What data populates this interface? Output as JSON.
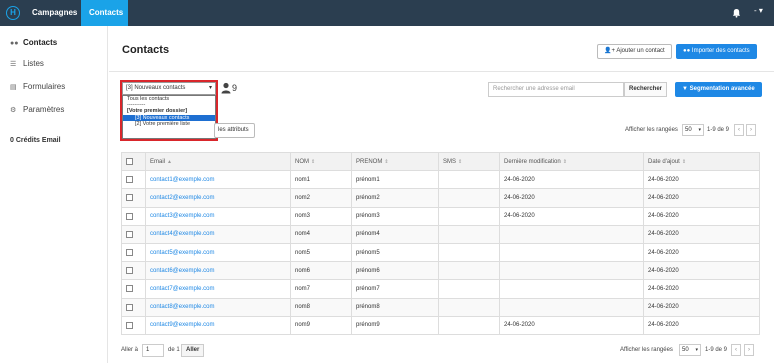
{
  "topnav": {
    "logo": "H",
    "tabs": [
      {
        "label": "Campagnes"
      },
      {
        "label": "Contacts"
      }
    ],
    "user_label": "-"
  },
  "sidebar": {
    "items": [
      {
        "label": "Contacts",
        "icon": "users-icon"
      },
      {
        "label": "Listes",
        "icon": "list-icon"
      },
      {
        "label": "Formulaires",
        "icon": "form-icon"
      },
      {
        "label": "Paramètres",
        "icon": "gear-icon"
      }
    ],
    "credits": "0 Crédits Email"
  },
  "header": {
    "title": "Contacts",
    "add_contact": "Ajouter un contact",
    "import_contacts": "Importer des contacts"
  },
  "list_select": {
    "value": "[3] Nouveaux contacts",
    "options": [
      "Tous les contacts",
      "----------",
      "[Votre premier dossier]",
      "[3] Nouveaux contacts",
      "[2] Votre première liste"
    ],
    "count": "9"
  },
  "attributes_button": "les attributs",
  "search": {
    "placeholder": "Rechercher une adresse email",
    "button": "Rechercher",
    "advanced": "Segmentation avancée"
  },
  "pagination": {
    "rows_label": "Afficher les rangées",
    "rows_value": "50",
    "range": "1-9 de 9",
    "prev": "‹",
    "next": "›"
  },
  "table": {
    "headers": [
      "Email",
      "NOM",
      "PRENOM",
      "SMS",
      "Dernière modification",
      "Date d'ajout"
    ],
    "rows": [
      [
        "contact1@exemple.com",
        "nom1",
        "prénom1",
        "",
        "24-06-2020",
        "24-06-2020"
      ],
      [
        "contact2@exemple.com",
        "nom2",
        "prénom2",
        "",
        "24-06-2020",
        "24-06-2020"
      ],
      [
        "contact3@exemple.com",
        "nom3",
        "prénom3",
        "",
        "24-06-2020",
        "24-06-2020"
      ],
      [
        "contact4@exemple.com",
        "nom4",
        "prénom4",
        "",
        "",
        "24-06-2020"
      ],
      [
        "contact5@exemple.com",
        "nom5",
        "prénom5",
        "",
        "",
        "24-06-2020"
      ],
      [
        "contact6@exemple.com",
        "nom6",
        "prénom6",
        "",
        "",
        "24-06-2020"
      ],
      [
        "contact7@exemple.com",
        "nom7",
        "prénom7",
        "",
        "",
        "24-06-2020"
      ],
      [
        "contact8@exemple.com",
        "nom8",
        "prénom8",
        "",
        "",
        "24-06-2020"
      ],
      [
        "contact9@exemple.com",
        "nom9",
        "prénom9",
        "",
        "24-06-2020",
        "24-06-2020"
      ]
    ]
  },
  "footer": {
    "goto_label": "Aller à",
    "goto_value": "1",
    "of_label": "de 1",
    "goto_button": "Aller",
    "rows_label": "Afficher les rangées",
    "rows_value": "50",
    "range": "1-9 de 9",
    "prev": "‹",
    "next": "›"
  },
  "colors": {
    "nav_bg": "#2b3e50",
    "accent": "#1aa3e8",
    "primary": "#1e88e5",
    "highlight_frame": "#d9262b"
  }
}
